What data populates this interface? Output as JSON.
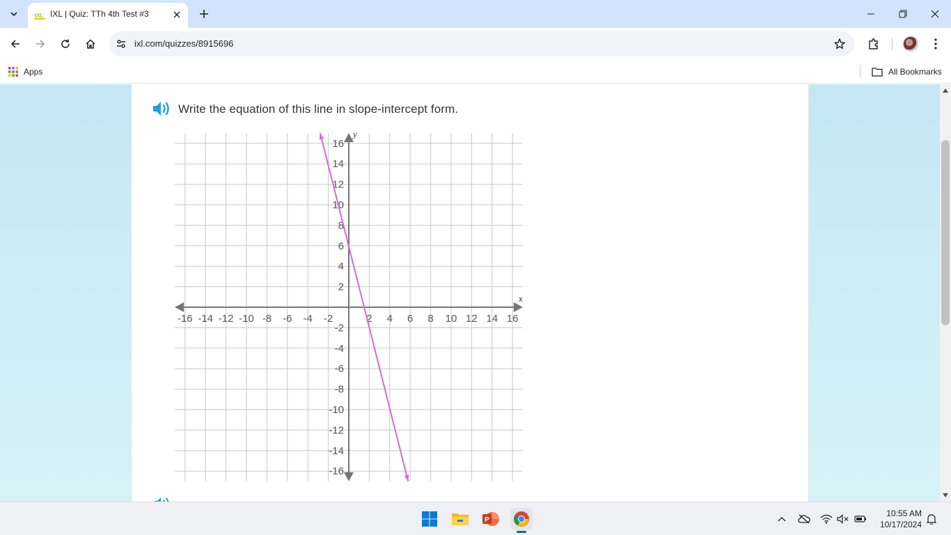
{
  "browser": {
    "tab": {
      "title": "IXL | Quiz: TTh 4th Test #3"
    },
    "address": {
      "url": "ixl.com/quizzes/8915696"
    },
    "bookmarks": {
      "apps_label": "Apps",
      "all_bookmarks_label": "All Bookmarks"
    }
  },
  "question": {
    "prompt": "Write the equation of this line in slope-intercept form."
  },
  "chart_data": {
    "type": "line",
    "title": "",
    "xlabel": "x",
    "ylabel": "y",
    "xlim": [
      -17,
      17
    ],
    "ylim": [
      -17,
      17
    ],
    "grid": true,
    "x_ticks": [
      "-16",
      "-14",
      "-12",
      "-10",
      "-8",
      "-6",
      "-4",
      "-2",
      "2",
      "4",
      "6",
      "8",
      "10",
      "12",
      "14",
      "16"
    ],
    "y_ticks": [
      "16",
      "14",
      "12",
      "10",
      "8",
      "6",
      "4",
      "2",
      "-2",
      "-4",
      "-6",
      "-8",
      "-10",
      "-12",
      "-14",
      "-16"
    ],
    "line": {
      "color": "#d966e0",
      "arrow_start": {
        "x": -2.8,
        "y": 17
      },
      "arrow_end": {
        "x": 5.8,
        "y": -17
      },
      "points": [
        {
          "x": 0,
          "y": 6
        },
        {
          "x": 1,
          "y": 2
        }
      ]
    }
  },
  "taskbar": {
    "time": "10:55 AM",
    "date": "10/17/2024"
  },
  "colors": {
    "accent": "#0067c0",
    "line": "#d966e0",
    "axis": "#757575",
    "grid": "#c8c8c8",
    "speaker": "#1ba1dd"
  }
}
